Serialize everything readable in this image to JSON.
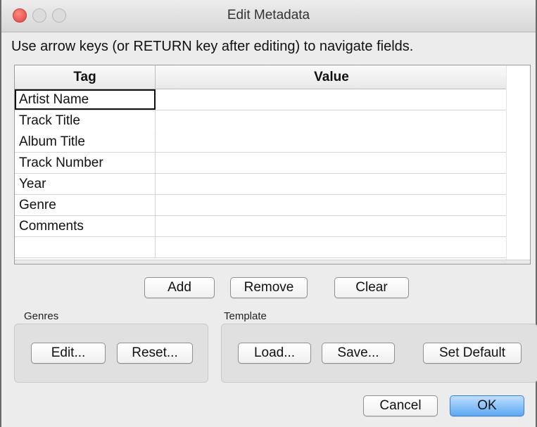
{
  "window": {
    "title": "Edit Metadata"
  },
  "instructions": "Use arrow keys (or RETURN key after editing) to navigate fields.",
  "table": {
    "headers": {
      "tag": "Tag",
      "value": "Value"
    },
    "rows": [
      {
        "tag": "Artist Name",
        "value": ""
      },
      {
        "tag": "Track Title",
        "value": ""
      },
      {
        "tag": "Album Title",
        "value": ""
      },
      {
        "tag": "Track Number",
        "value": ""
      },
      {
        "tag": "Year",
        "value": ""
      },
      {
        "tag": "Genre",
        "value": ""
      },
      {
        "tag": "Comments",
        "value": ""
      },
      {
        "tag": "",
        "value": ""
      }
    ]
  },
  "row_buttons": {
    "add": "Add",
    "remove": "Remove",
    "clear": "Clear"
  },
  "genres": {
    "label": "Genres",
    "edit": "Edit...",
    "reset": "Reset..."
  },
  "template": {
    "label": "Template",
    "load": "Load...",
    "save": "Save...",
    "set_default": "Set Default"
  },
  "dialog_buttons": {
    "cancel": "Cancel",
    "ok": "OK"
  },
  "colors": {
    "close": "#e0443e",
    "ok_accent": "#5aa8f3"
  }
}
